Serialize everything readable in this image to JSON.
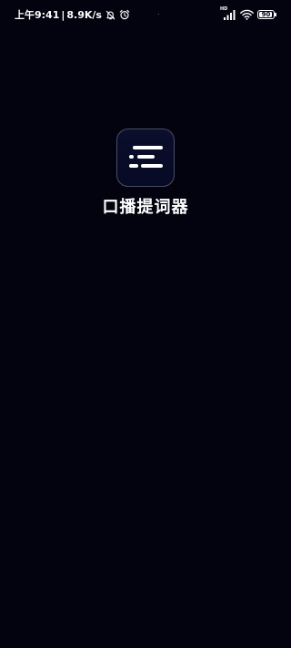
{
  "status_bar": {
    "time": "上午9:41",
    "separator": "|",
    "net_speed": "8.9K/s",
    "silent_icon": "bell-off-icon",
    "alarm_icon": "alarm-clock-icon",
    "signal_label": "HD",
    "signal_icon": "cellular-signal-icon",
    "wifi_icon": "wifi-icon",
    "battery_level": "90",
    "battery_fraction": 0.9
  },
  "splash": {
    "app_icon": "text-lines-icon",
    "app_name": "口播提词器"
  },
  "colors": {
    "background": "#02030e",
    "icon_border": "#4b4e63",
    "icon_fill": "#0a0d28",
    "text": "#ffffff"
  }
}
